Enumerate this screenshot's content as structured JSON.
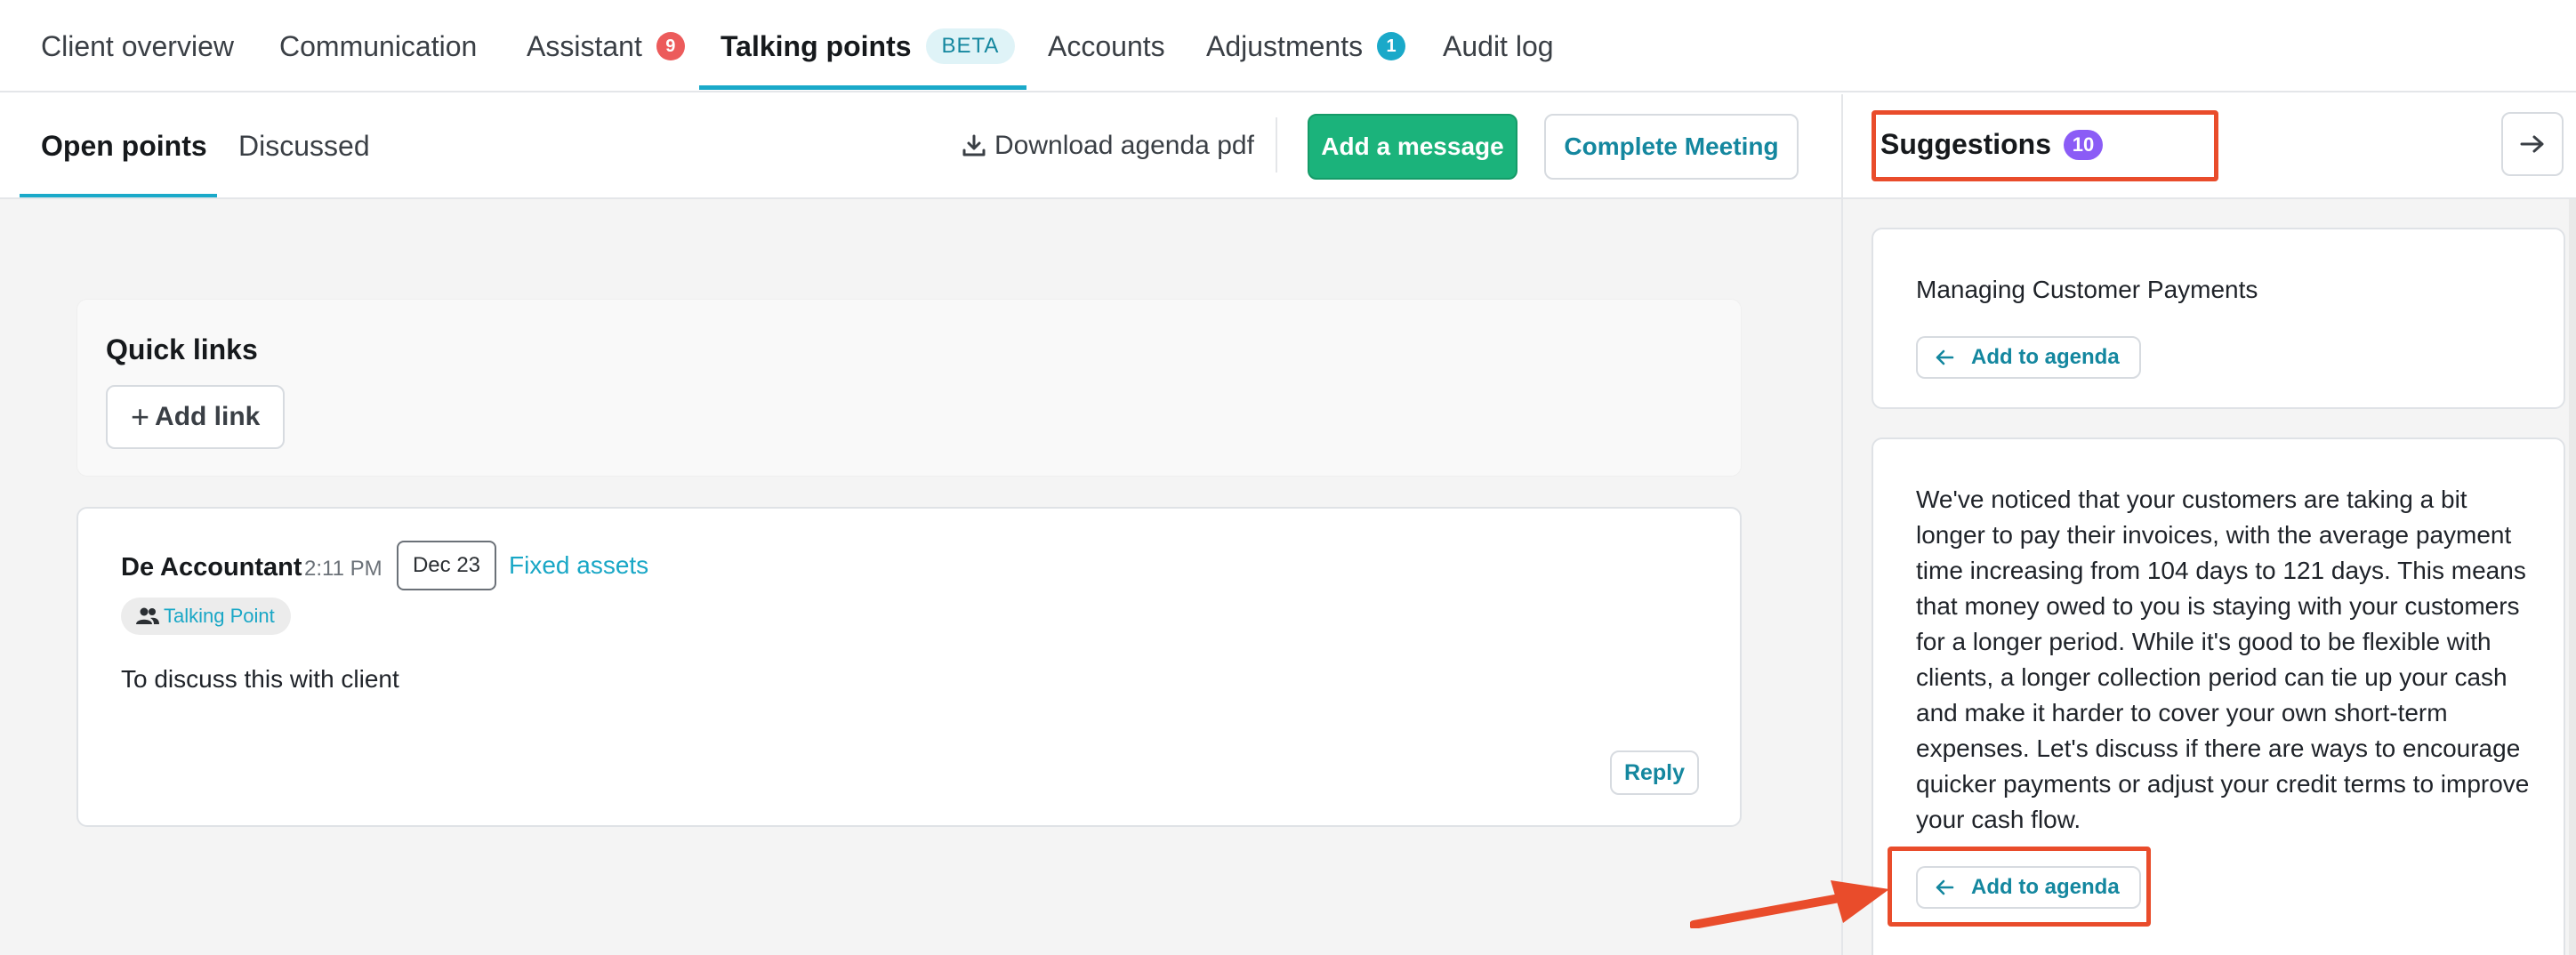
{
  "top_nav": {
    "tabs": [
      {
        "label": "Client overview"
      },
      {
        "label": "Communication"
      },
      {
        "label": "Assistant",
        "badge": "9",
        "badge_color": "#ec5b5b"
      },
      {
        "label": "Talking points",
        "tag": "BETA",
        "active": true
      },
      {
        "label": "Accounts"
      },
      {
        "label": "Adjustments",
        "badge": "1",
        "badge_color": "#1aa9c9"
      },
      {
        "label": "Audit log"
      }
    ]
  },
  "subbar": {
    "tabs": [
      {
        "label": "Open points",
        "active": true
      },
      {
        "label": "Discussed"
      }
    ],
    "download_label": "Download agenda pdf",
    "add_message_label": "Add a message",
    "complete_meeting_label": "Complete Meeting"
  },
  "quick_links": {
    "title": "Quick links",
    "add_label": "Add link"
  },
  "message": {
    "author": "De Accountant",
    "time": "2:11 PM",
    "date": "Dec 23",
    "tag_link": "Fixed assets",
    "badge": "Talking Point",
    "body": "To discuss this with client",
    "reply_label": "Reply"
  },
  "suggestions": {
    "title": "Suggestions",
    "count": "10",
    "items": [
      {
        "title": "Managing Customer Payments",
        "action": "Add to agenda"
      },
      {
        "body": "We've noticed that your customers are taking a bit longer to pay their invoices, with the average payment time increasing from 104 days to 121 days. This means that money owed to you is staying with your customers for a longer period. While it's good to be flexible with clients, a longer collection period can tie up your cash and make it harder to cover your own short-term expenses. Let's discuss if there are ways to encourage quicker payments or adjust your credit terms to improve your cash flow.",
        "action": "Add to agenda"
      }
    ]
  },
  "colors": {
    "accent": "#1aa9c9",
    "primary_button": "#1bb37b",
    "annotation": "#e94c2b",
    "suggestion_count": "#8b5cf6"
  },
  "icons": {
    "download": "download-icon",
    "plus": "plus-icon",
    "people": "people-icon",
    "arrow_left": "arrow-left-icon",
    "arrow_right": "arrow-right-icon"
  }
}
